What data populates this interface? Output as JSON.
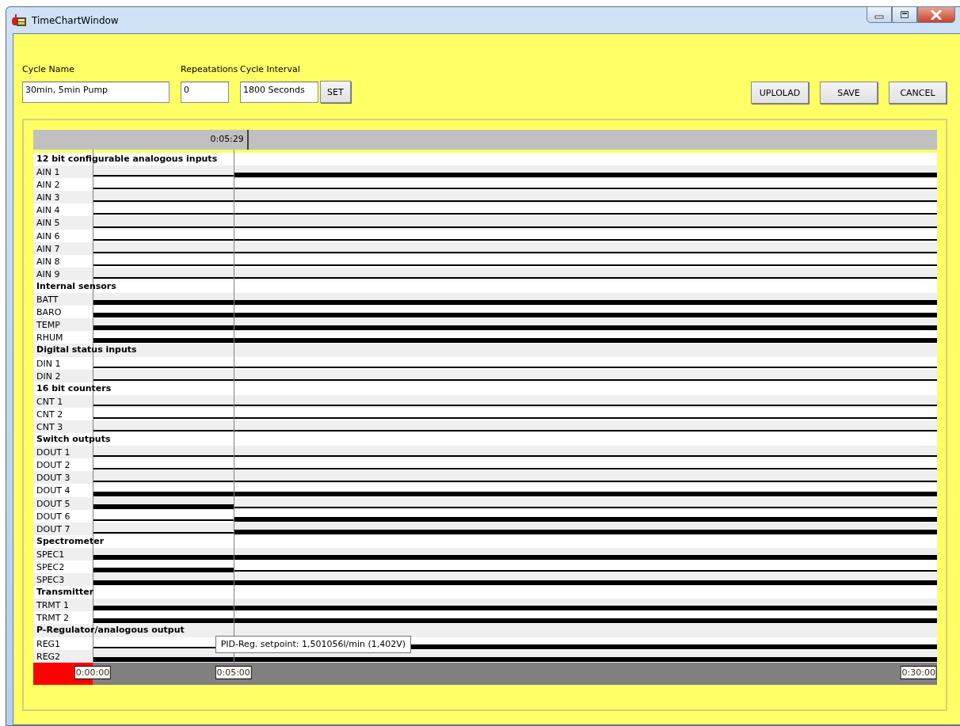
{
  "window": {
    "title": "TimeChartWindow"
  },
  "form": {
    "cycle_name": {
      "label": "Cycle Name",
      "value": "30min, 5min Pump"
    },
    "repetitions": {
      "label": "Repeatations",
      "value": "0"
    },
    "cycle_interval": {
      "label": "Cycle Interval",
      "value": "1800 Seconds"
    },
    "set_button": "SET"
  },
  "buttons": [
    "UPLOLAD",
    "SAVE",
    "CANCEL"
  ],
  "chart": {
    "cursor": "0:05:29",
    "marks": [
      "0:00:00",
      "0:05:00",
      "0:30:00"
    ],
    "tooltip": "PID-Reg. setpoint: 1,501056l/min (1,402V)",
    "groups": [
      {
        "title": "12 bit configurable analogous inputs",
        "channels": [
          {
            "name": "AIN 1",
            "segments": [
              {
                "thick": false
              },
              {
                "thick": true
              }
            ]
          },
          {
            "name": "AIN 2",
            "segments": [
              {
                "thick": false
              },
              {
                "thick": false
              }
            ]
          },
          {
            "name": "AIN 3",
            "segments": [
              {
                "thick": false
              },
              {
                "thick": false
              }
            ]
          },
          {
            "name": "AIN 4",
            "segments": [
              {
                "thick": false
              },
              {
                "thick": false
              }
            ]
          },
          {
            "name": "AIN 5",
            "segments": [
              {
                "thick": false
              },
              {
                "thick": false
              }
            ]
          },
          {
            "name": "AIN 6",
            "segments": [
              {
                "thick": false
              },
              {
                "thick": false
              }
            ]
          },
          {
            "name": "AIN 7",
            "segments": [
              {
                "thick": false
              },
              {
                "thick": false
              }
            ]
          },
          {
            "name": "AIN 8",
            "segments": [
              {
                "thick": false
              },
              {
                "thick": false
              }
            ]
          },
          {
            "name": "AIN 9",
            "segments": [
              {
                "thick": false
              },
              {
                "thick": false
              }
            ]
          }
        ]
      },
      {
        "title": "Internal sensors",
        "channels": [
          {
            "name": "BATT",
            "segments": [
              {
                "thick": true
              },
              {
                "thick": true
              }
            ]
          },
          {
            "name": "BARO",
            "segments": [
              {
                "thick": true
              },
              {
                "thick": true
              }
            ]
          },
          {
            "name": "TEMP",
            "segments": [
              {
                "thick": true
              },
              {
                "thick": true
              }
            ]
          },
          {
            "name": "RHUM",
            "segments": [
              {
                "thick": true
              },
              {
                "thick": true
              }
            ]
          }
        ]
      },
      {
        "title": "Digital status inputs",
        "channels": [
          {
            "name": "DIN 1",
            "segments": [
              {
                "thick": false
              },
              {
                "thick": false
              }
            ]
          },
          {
            "name": "DIN 2",
            "segments": [
              {
                "thick": false
              },
              {
                "thick": false
              }
            ]
          }
        ]
      },
      {
        "title": "16 bit counters",
        "channels": [
          {
            "name": "CNT 1",
            "segments": [
              {
                "thick": false
              },
              {
                "thick": false
              }
            ]
          },
          {
            "name": "CNT 2",
            "segments": [
              {
                "thick": false
              },
              {
                "thick": false
              }
            ]
          },
          {
            "name": "CNT 3",
            "segments": [
              {
                "thick": false
              },
              {
                "thick": false
              }
            ]
          }
        ]
      },
      {
        "title": "Switch outputs",
        "channels": [
          {
            "name": "DOUT 1",
            "segments": [
              {
                "thick": false
              },
              {
                "thick": false
              }
            ]
          },
          {
            "name": "DOUT 2",
            "segments": [
              {
                "thick": false
              },
              {
                "thick": false
              }
            ]
          },
          {
            "name": "DOUT 3",
            "segments": [
              {
                "thick": false
              },
              {
                "thick": false
              }
            ]
          },
          {
            "name": "DOUT 4",
            "segments": [
              {
                "thick": true
              },
              {
                "thick": true
              }
            ]
          },
          {
            "name": "DOUT 5",
            "segments": [
              {
                "thick": true
              },
              {
                "thick": false
              }
            ]
          },
          {
            "name": "DOUT 6",
            "segments": [
              {
                "thick": false
              },
              {
                "thick": true
              }
            ]
          },
          {
            "name": "DOUT 7",
            "segments": [
              {
                "thick": false
              },
              {
                "thick": true
              }
            ]
          }
        ]
      },
      {
        "title": "Spectrometer",
        "channels": [
          {
            "name": "SPEC1",
            "segments": [
              {
                "thick": true
              },
              {
                "thick": true
              }
            ]
          },
          {
            "name": "SPEC2",
            "segments": [
              {
                "thick": true
              },
              {
                "thick": false
              }
            ]
          },
          {
            "name": "SPEC3",
            "segments": [
              {
                "thick": true
              },
              {
                "thick": true
              }
            ]
          }
        ]
      },
      {
        "title": "Transmitter",
        "channels": [
          {
            "name": "TRMT 1",
            "segments": [
              {
                "thick": true
              },
              {
                "thick": true
              }
            ]
          },
          {
            "name": "TRMT 2",
            "segments": [
              {
                "thick": true
              },
              {
                "thick": true
              }
            ]
          }
        ]
      },
      {
        "title": "P-Regulator/analogous output",
        "channels": [
          {
            "name": "REG1",
            "segments": [
              {
                "thick": false
              },
              {
                "thick": true
              }
            ]
          },
          {
            "name": "REG2",
            "segments": [
              {
                "thick": true
              },
              {
                "thick": true
              }
            ]
          }
        ]
      }
    ]
  }
}
